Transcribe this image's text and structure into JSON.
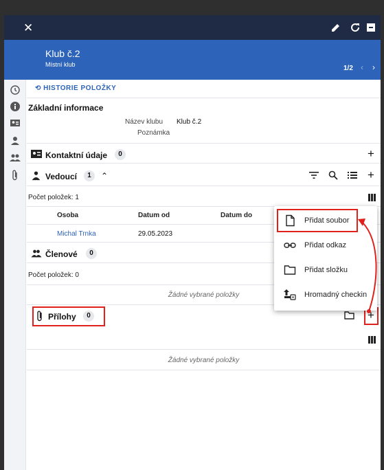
{
  "header": {
    "title": "Klub č.2",
    "subtitle": "Místní klub",
    "pager": "1/2"
  },
  "history_link": "HISTORIE POLOŽKY",
  "basic_info": {
    "heading": "Základní informace",
    "name_label": "Název klubu",
    "name_value": "Klub č.2",
    "note_label": "Poznámka"
  },
  "contacts": {
    "label": "Kontaktní údaje",
    "count": "0"
  },
  "leaders": {
    "label": "Vedoucí",
    "count": "1",
    "items_count": "Počet položek: 1",
    "columns": [
      "Osoba",
      "Datum od",
      "Datum do"
    ],
    "rows": [
      [
        "Michal Trnka",
        "29.05.2023",
        ""
      ]
    ]
  },
  "members": {
    "label": "Členové",
    "count": "0",
    "items_count": "Počet položek: 0",
    "empty": "Žádné vybrané položky"
  },
  "attachments": {
    "label": "Přílohy",
    "count": "0",
    "empty": "Žádné vybrané položky"
  },
  "menu": {
    "items": [
      {
        "label": "Přidat soubor",
        "icon": "file-icon"
      },
      {
        "label": "Přidat odkaz",
        "icon": "link-icon"
      },
      {
        "label": "Přidat složku",
        "icon": "folder-icon"
      },
      {
        "label": "Hromadný checkin",
        "icon": "checkin-icon"
      }
    ]
  },
  "colors": {
    "header_dark": "#1f2a44",
    "header_blue": "#2d63b8",
    "link_blue": "#2d63b8",
    "highlight_red": "#e0201b"
  }
}
